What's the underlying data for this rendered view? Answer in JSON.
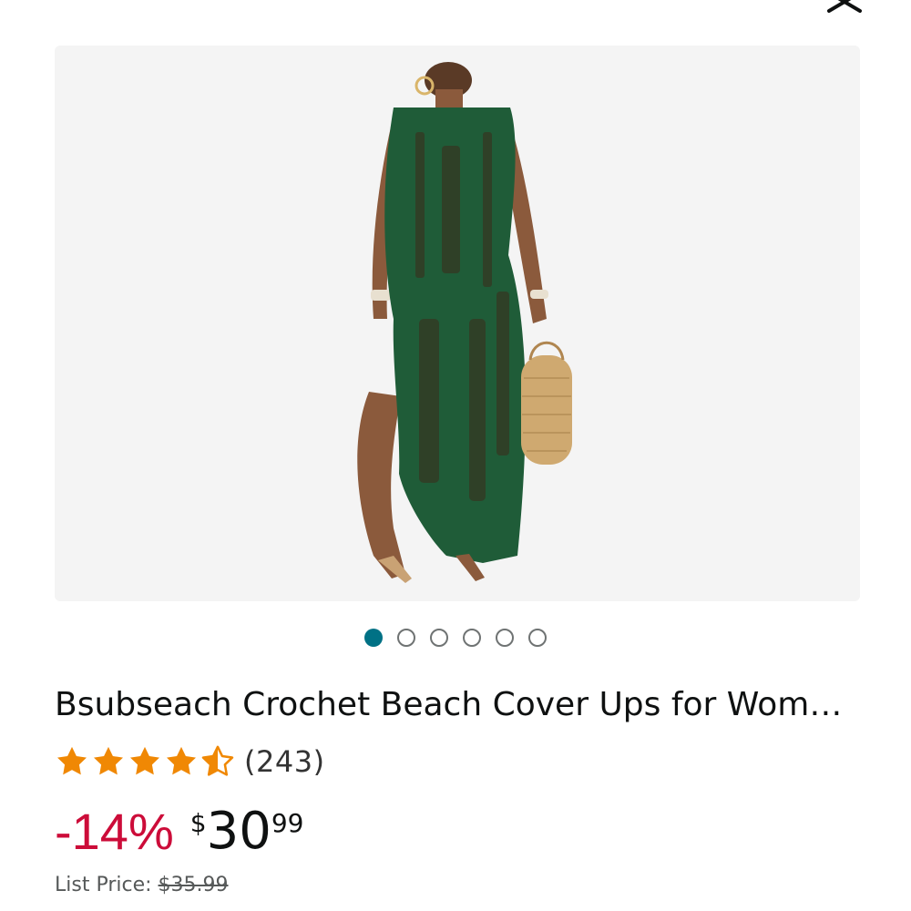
{
  "icons": {
    "close": "close-icon",
    "star_full": "star-full-icon",
    "star_half": "star-half-icon"
  },
  "carousel": {
    "total_images": 6,
    "active_index": 0
  },
  "product": {
    "title": "Bsubseach Crochet Beach Cover Ups for Wom…",
    "rating": 4.5,
    "review_count": "(243)",
    "discount": "-14%",
    "price_symbol": "$",
    "price_whole": "30",
    "price_fraction": "99",
    "list_price_label": "List Price:",
    "list_price": "$35.99"
  },
  "colors": {
    "accent": "#007185",
    "discount": "#CC0C39",
    "star": "#F08804",
    "text": "#0F1111",
    "muted": "#565959",
    "dress": "#1f5c38"
  }
}
